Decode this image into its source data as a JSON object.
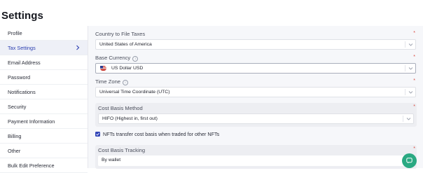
{
  "page": {
    "title": "Settings"
  },
  "sidebar": {
    "items": [
      {
        "label": "Profile"
      },
      {
        "label": "Tax Settings"
      },
      {
        "label": "Email Address"
      },
      {
        "label": "Password"
      },
      {
        "label": "Notifications"
      },
      {
        "label": "Security"
      },
      {
        "label": "Payment Information"
      },
      {
        "label": "Billing"
      },
      {
        "label": "Other"
      },
      {
        "label": "Bulk Edit Preference"
      }
    ],
    "active": "Tax Settings"
  },
  "form": {
    "country": {
      "label": "Country to File Taxes",
      "value": "United States of America",
      "required": "*"
    },
    "currency": {
      "label": "Base Currency",
      "value": "US Dollar USD",
      "required": "*",
      "flag_icon": "us-flag-icon"
    },
    "timezone": {
      "label": "Time Zone",
      "value": "Universal Time Coordinate (UTC)",
      "required": "*"
    },
    "cost_basis_method": {
      "label": "Cost Basis Method",
      "value": "HIFO (Highest in, first out)",
      "required": "*"
    },
    "nft_checkbox": {
      "label": "NFTs transfer cost basis when traded for other NFTs",
      "checked": true
    },
    "cost_basis_tracking": {
      "label": "Cost Basis Tracking",
      "value": "By wallet",
      "required": "*"
    }
  },
  "colors": {
    "accent": "#3346b8",
    "chat": "#2aa982",
    "required": "#d9443a"
  }
}
